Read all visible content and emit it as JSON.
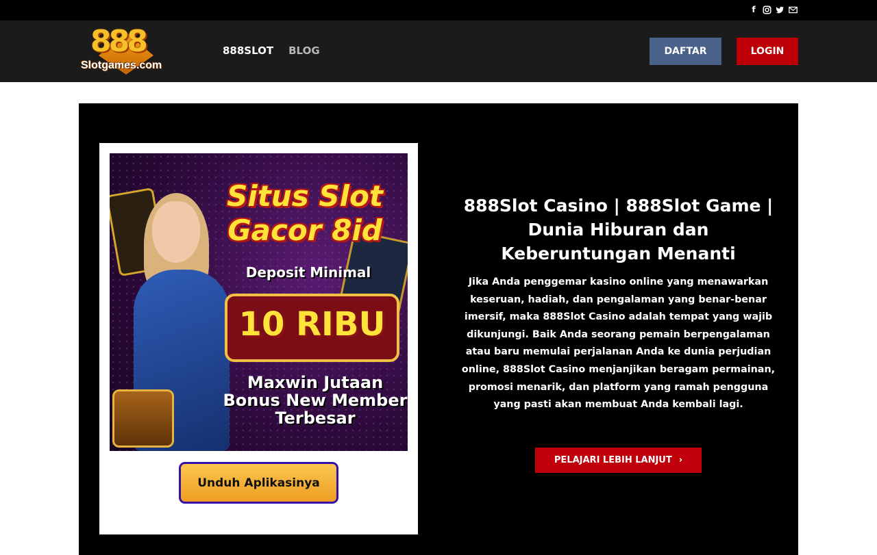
{
  "social": {
    "facebook": "f",
    "instagram": "instagram-icon",
    "twitter": "twitter-icon",
    "email": "email-icon"
  },
  "header": {
    "logo_number": "888",
    "logo_text": "Slotgames.com",
    "nav": [
      {
        "label": "888SLOT"
      },
      {
        "label": "BLOG"
      }
    ],
    "daftar_label": "DAFTAR",
    "login_label": "LOGIN"
  },
  "hero": {
    "banner": {
      "title": "Situs Slot Gacor 8id",
      "deposit": "Deposit Minimal",
      "amount": "10 RIBU",
      "promo": "Maxwin Jutaan Bonus New Member Terbesar"
    },
    "download_label": "Unduh Aplikasinya",
    "heading": "888Slot Casino | 888Slot Game | Dunia Hiburan dan Keberuntungan Menanti",
    "body": "Jika Anda penggemar kasino online yang menawarkan keseruan, hadiah, dan pengalaman yang benar-benar imersif, maka 888Slot Casino adalah tempat yang wajib dikunjungi. Baik Anda seorang pemain berpengalaman atau baru memulai perjalanan Anda ke dunia perjudian online, 888Slot Casino menjanjikan beragam permainan, promosi menarik, dan platform yang ramah pengguna yang pasti akan membuat Anda kembali lagi.",
    "learn_more_label": "PELAJARI LEBIH LANJUT",
    "learn_more_arrow": "›"
  },
  "colors": {
    "header_bg": "#1b1b1b",
    "daftar": "#4a6289",
    "login": "#bd0007",
    "cta": "#c0000a",
    "download_gold": "#f3b136",
    "download_border": "#3611a8"
  }
}
